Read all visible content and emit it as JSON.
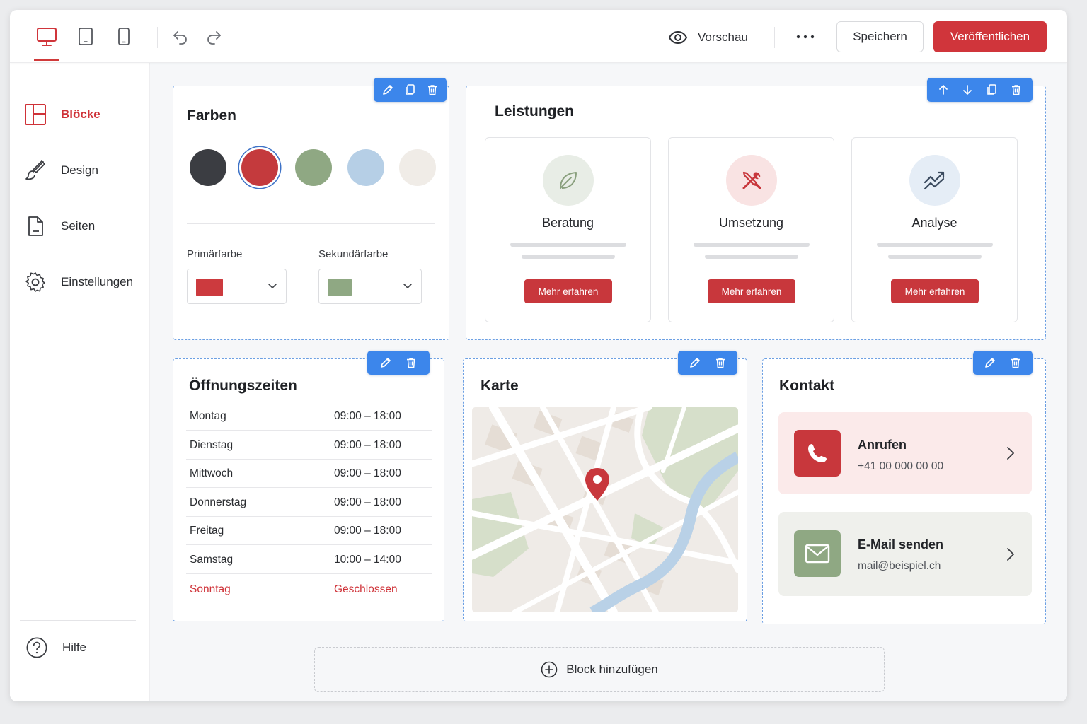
{
  "toolbar": {
    "preview_label": "Vorschau",
    "save_label": "Speichern",
    "publish_label": "Veröffentlichen"
  },
  "sidebar": {
    "items": [
      {
        "label": "Blöcke",
        "icon": "blocks-icon",
        "active": true
      },
      {
        "label": "Design",
        "icon": "brush-icon",
        "active": false
      },
      {
        "label": "Seiten",
        "icon": "page-icon",
        "active": false
      },
      {
        "label": "Einstellungen",
        "icon": "gear-icon",
        "active": false
      }
    ],
    "help_label": "Hilfe"
  },
  "farben": {
    "title": "Farben",
    "swatches": [
      "#3b3d42",
      "#c43a3d",
      "#8fa883",
      "#b6cfe6",
      "#f0ece7"
    ],
    "selected_index": 1,
    "primary_label": "Primärfarbe",
    "primary_color": "#cc3a3e",
    "secondary_label": "Sekundärfarbe",
    "secondary_color": "#8fa883"
  },
  "leistungen": {
    "title": "Leistungen",
    "services": [
      {
        "name": "Beratung",
        "icon": "leaf-icon",
        "button": "Mehr erfahren"
      },
      {
        "name": "Umsetzung",
        "icon": "tools-icon",
        "button": "Mehr erfahren"
      },
      {
        "name": "Analyse",
        "icon": "trend-icon",
        "button": "Mehr erfahren"
      }
    ]
  },
  "hours": {
    "title": "Öffnungszeiten",
    "rows": [
      {
        "day": "Montag",
        "time": "09:00 – 18:00"
      },
      {
        "day": "Dienstag",
        "time": "09:00 – 18:00"
      },
      {
        "day": "Mittwoch",
        "time": "09:00 – 18:00"
      },
      {
        "day": "Donnerstag",
        "time": "09:00 – 18:00"
      },
      {
        "day": "Freitag",
        "time": "09:00 – 18:00"
      },
      {
        "day": "Samstag",
        "time": "10:00 – 14:00"
      },
      {
        "day": "Sonntag",
        "time": "Geschlossen"
      }
    ]
  },
  "map": {
    "title": "Karte"
  },
  "contact": {
    "title": "Kontakt",
    "phone": {
      "title": "Anrufen",
      "value": "+41 00 000 00 00"
    },
    "email": {
      "title": "E-Mail senden",
      "value": "mail@beispiel.ch"
    }
  },
  "add_block_label": "Block hinzufügen",
  "colors": {
    "accent": "#d0353b",
    "edit_blue": "#3c86eb"
  }
}
